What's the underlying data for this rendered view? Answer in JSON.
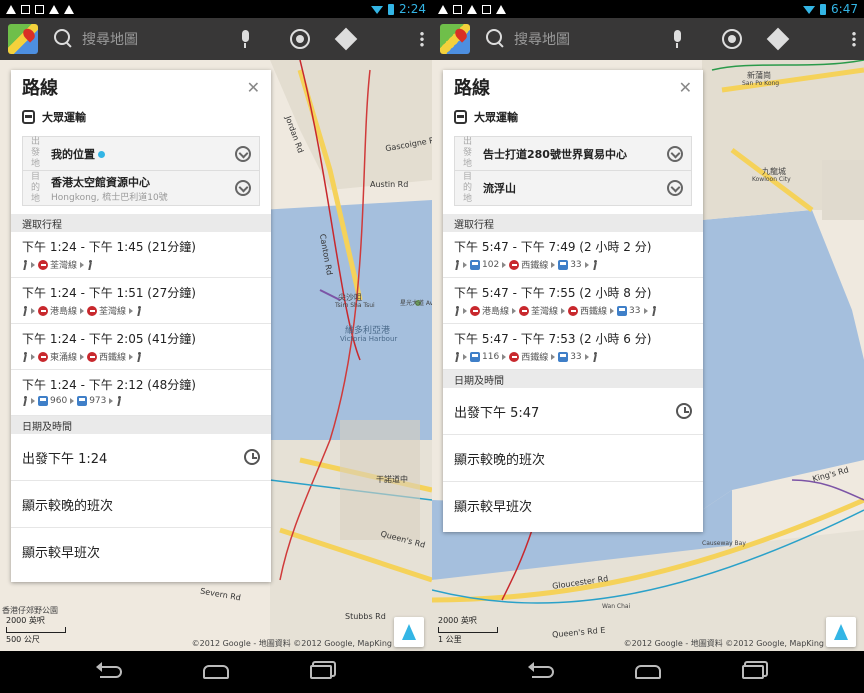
{
  "left": {
    "status_time": "2:24",
    "search_placeholder": "搜尋地圖",
    "panel": {
      "title": "路線",
      "mode": "大眾運輸",
      "origin_key": "出發地",
      "origin": "我的位置",
      "destination_key": "目的地",
      "destination": "香港太空館資源中心",
      "destination_sub": "Hongkong, 梳士巴利道10號",
      "trips_header": "選取行程",
      "trips": [
        {
          "time": "下午 1:24 - 下午 1:45 (21分鐘)",
          "legs": [
            {
              "t": "walk"
            },
            {
              "t": "mtr",
              "label": "荃灣線"
            },
            {
              "t": "walk"
            }
          ]
        },
        {
          "time": "下午 1:24 - 下午 1:51 (27分鐘)",
          "legs": [
            {
              "t": "walk"
            },
            {
              "t": "mtr",
              "label": "港島線"
            },
            {
              "t": "mtr",
              "label": "荃灣線"
            },
            {
              "t": "walk"
            }
          ]
        },
        {
          "time": "下午 1:24 - 下午 2:05 (41分鐘)",
          "legs": [
            {
              "t": "walk"
            },
            {
              "t": "mtr",
              "label": "東涌線"
            },
            {
              "t": "mtr",
              "label": "西鐵線"
            },
            {
              "t": "walk"
            }
          ]
        },
        {
          "time": "下午 1:24 - 下午 2:12 (48分鐘)",
          "legs": [
            {
              "t": "walk"
            },
            {
              "t": "bus",
              "label": "960"
            },
            {
              "t": "bus",
              "label": "973"
            },
            {
              "t": "walk"
            }
          ]
        }
      ],
      "datetime_header": "日期及時間",
      "depart": "出發下午 1:24",
      "later": "顯示較晚的班次",
      "earlier": "顯示較早班次"
    },
    "map_labels": {
      "jordan_rd": "Jordan Rd",
      "gascoigne_rd": "Gascoigne R",
      "austin_rd": "Austin Rd",
      "canton_rd": "Canton Rd",
      "tst": "尖沙咀",
      "tst_en": "Tsim Sha Tsui",
      "harbour": "維多利亞港",
      "harbour_en": "Victoria Harbour",
      "connaught": "干諾道中",
      "queens": "Queen's Rd",
      "severn": "Severn Rd",
      "stubbs": "Stubbs Rd",
      "avenue": "星光大道 Avenue"
    },
    "scale_imperial": "2000 英呎",
    "scale_metric": "500 公尺",
    "copyright": "©2012 Google - 地圖資料 ©2012 Google, MapKing",
    "park_label": "香港仔郊野公園"
  },
  "right": {
    "status_time": "6:47",
    "search_placeholder": "搜尋地圖",
    "panel": {
      "title": "路線",
      "mode": "大眾運輸",
      "origin_key": "出發地",
      "origin": "告士打道280號世界貿易中心",
      "destination_key": "目的地",
      "destination": "流浮山",
      "trips_header": "選取行程",
      "trips": [
        {
          "time": "下午 5:47 - 下午 7:49 (2 小時 2 分)",
          "legs": [
            {
              "t": "walk"
            },
            {
              "t": "bus",
              "label": "102"
            },
            {
              "t": "mtr",
              "label": "西鐵線"
            },
            {
              "t": "bus",
              "label": "33"
            },
            {
              "t": "walk"
            }
          ]
        },
        {
          "time": "下午 5:47 - 下午 7:55 (2 小時 8 分)",
          "legs": [
            {
              "t": "walk"
            },
            {
              "t": "mtr",
              "label": "港島線"
            },
            {
              "t": "mtr",
              "label": "荃灣線"
            },
            {
              "t": "mtr",
              "label": "西鐵線"
            },
            {
              "t": "bus",
              "label": "33"
            },
            {
              "t": "walk"
            }
          ]
        },
        {
          "time": "下午 5:47 - 下午 7:53 (2 小時 6 分)",
          "legs": [
            {
              "t": "walk"
            },
            {
              "t": "bus",
              "label": "116"
            },
            {
              "t": "mtr",
              "label": "西鐵線"
            },
            {
              "t": "bus",
              "label": "33"
            },
            {
              "t": "walk"
            }
          ]
        }
      ],
      "datetime_header": "日期及時間",
      "depart": "出發下午 5:47",
      "later": "顯示較晚的班次",
      "earlier": "顯示較早班次"
    },
    "map_labels": {
      "sanpokong": "新蒲崗",
      "sanpokong_en": "San Po Kong",
      "kowloon_city": "九龍城",
      "kowloon_city_en": "Kowloon City",
      "kings_rd": "King's Rd",
      "gloucester": "Gloucester Rd",
      "queens_e": "Queen's Rd E",
      "wan_chai": "Wan Chai",
      "causeway": "Causeway Bay"
    },
    "scale_imperial": "2000 英呎",
    "scale_metric": "1 公里",
    "copyright": "©2012 Google - 地圖資料 ©2012 Google, MapKing"
  },
  "colors": {
    "mtr_red": "#c8282d",
    "bus_blue": "#3f7fc8",
    "accent": "#33b5e5",
    "water": "#a5bfdd",
    "road_yellow": "#f5d25a"
  }
}
